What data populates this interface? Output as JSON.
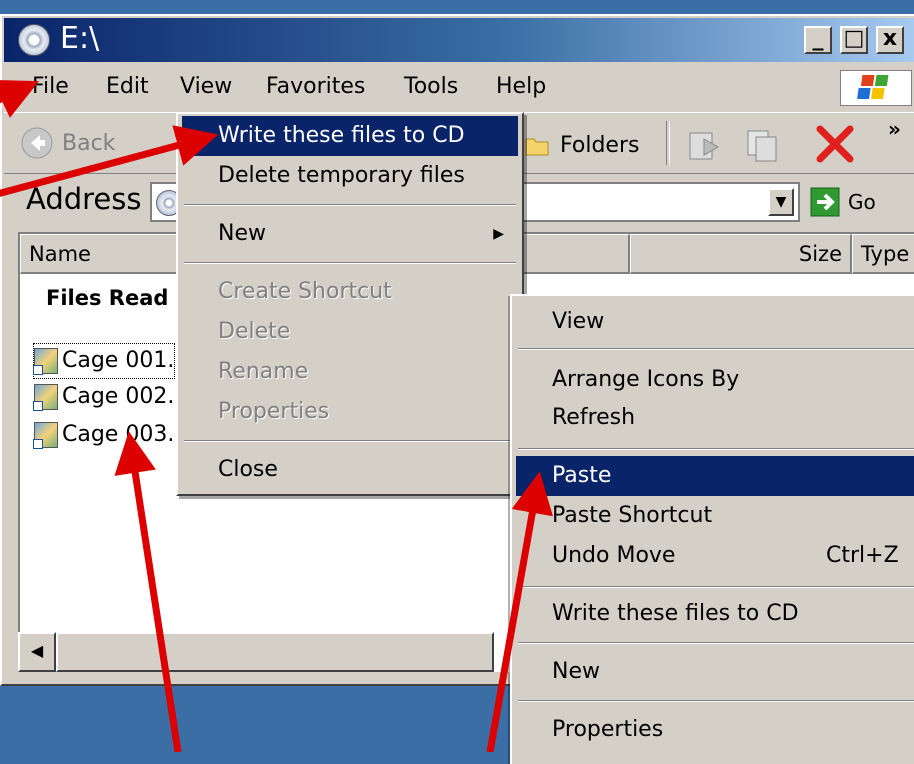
{
  "window": {
    "title": "E:\\",
    "caption_buttons": [
      "_",
      "□",
      "x"
    ]
  },
  "menubar": {
    "file": "File",
    "edit": "Edit",
    "view": "View",
    "favorites": "Favorites",
    "tools": "Tools",
    "help": "Help"
  },
  "toolbar": {
    "back": "Back",
    "folders": "Folders",
    "chevron": "»"
  },
  "address": {
    "label": "Address",
    "go": "Go"
  },
  "columns": {
    "name": "Name",
    "size": "Size",
    "type": "Type"
  },
  "list": {
    "group_header": "Files Read",
    "files": [
      "Cage 001.",
      "Cage 002.",
      "Cage 003."
    ]
  },
  "file_menu": {
    "write_cd": "Write these files to CD",
    "delete_temp": "Delete temporary files",
    "new": "New",
    "create_shortcut": "Create Shortcut",
    "delete": "Delete",
    "rename": "Rename",
    "properties": "Properties",
    "close": "Close"
  },
  "context_menu": {
    "view": "View",
    "arrange": "Arrange Icons By",
    "refresh": "Refresh",
    "paste": "Paste",
    "paste_shortcut": "Paste Shortcut",
    "undo_move": "Undo Move",
    "undo_shortcut": "Ctrl+Z",
    "write_cd": "Write these files to CD",
    "new": "New",
    "properties": "Properties"
  },
  "colors": {
    "desktop": "#3a6ea5",
    "highlight": "#0a246a",
    "annotation_arrow": "#dd0000"
  }
}
